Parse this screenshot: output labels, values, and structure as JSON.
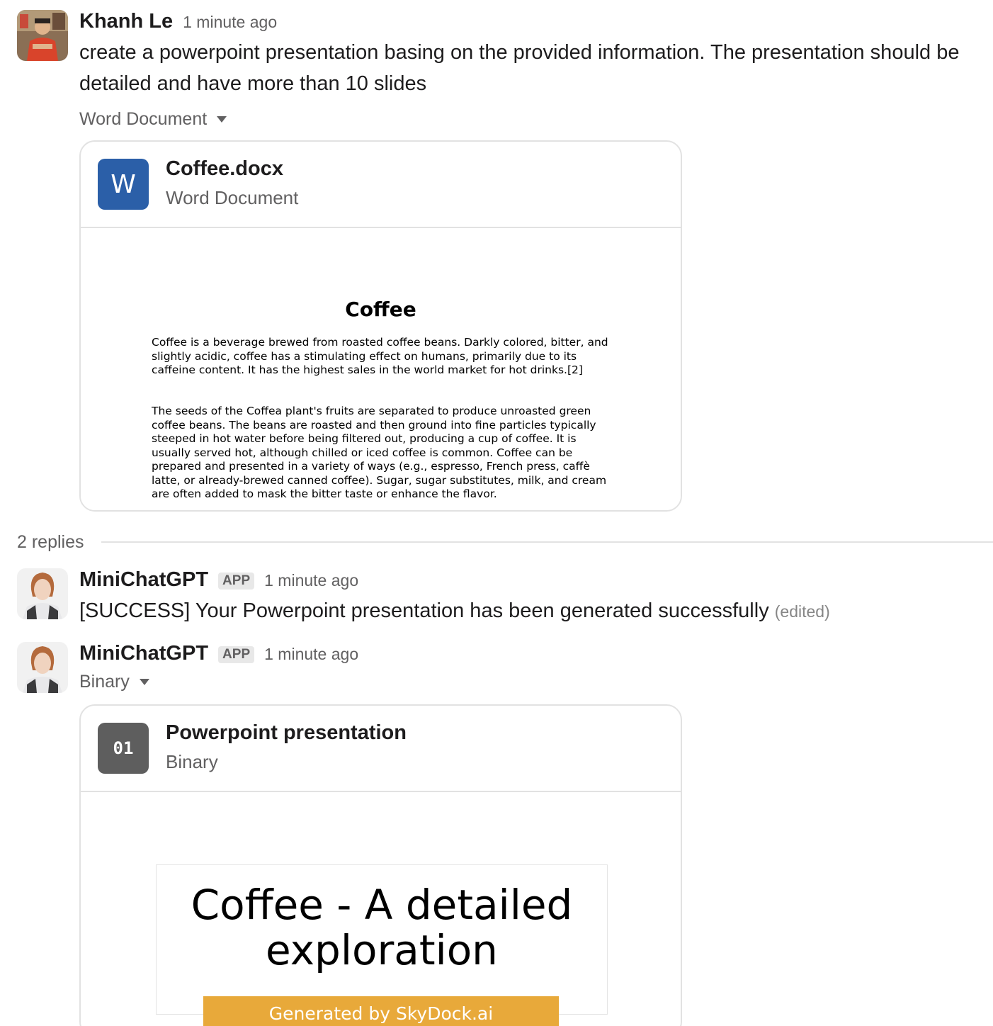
{
  "messages": [
    {
      "sender": "Khanh Le",
      "time": "1 minute ago",
      "text": "create a powerpoint presentation basing on the provided information. The presentation should be detailed and have more than 10 slides",
      "attachment_label": "Word Document",
      "file": {
        "icon_letter": "W",
        "name": "Coffee.docx",
        "type": "Word Document",
        "preview": {
          "title": "Coffee",
          "paragraph1": "Coffee is a beverage brewed from roasted coffee beans. Darkly colored, bitter, and slightly acidic, coffee has a stimulating effect on humans, primarily due to its caffeine content. It has the highest sales in the world market for hot drinks.[2]",
          "paragraph2": "The seeds of the Coffea plant's fruits are separated to produce unroasted green coffee beans. The beans are roasted and then ground into fine particles typically steeped in hot water before being filtered out, producing a cup of coffee. It is usually served hot, although chilled or iced coffee is common. Coffee can be prepared and presented in a variety of ways (e.g., espresso, French press, caffè latte, or already-brewed canned coffee). Sugar, sugar substitutes, milk, and cream are often added to mask the bitter taste or enhance the flavor."
        }
      }
    }
  ],
  "replies_label": "2 replies",
  "replies": [
    {
      "sender": "MiniChatGPT",
      "badge": "APP",
      "time": "1 minute ago",
      "text": "[SUCCESS] Your Powerpoint presentation has been generated successfully",
      "edited": "(edited)"
    },
    {
      "sender": "MiniChatGPT",
      "badge": "APP",
      "time": "1 minute ago",
      "attachment_label": "Binary",
      "file": {
        "icon_text": "01",
        "name": "Powerpoint presentation",
        "type": "Binary",
        "preview": {
          "slide_title": "Coffee - A detailed exploration",
          "banner": "Generated by SkyDock.ai"
        }
      }
    }
  ],
  "colors": {
    "word_icon": "#2b5fa8",
    "binary_icon": "#5e5e5e",
    "banner": "#e8a93a"
  }
}
